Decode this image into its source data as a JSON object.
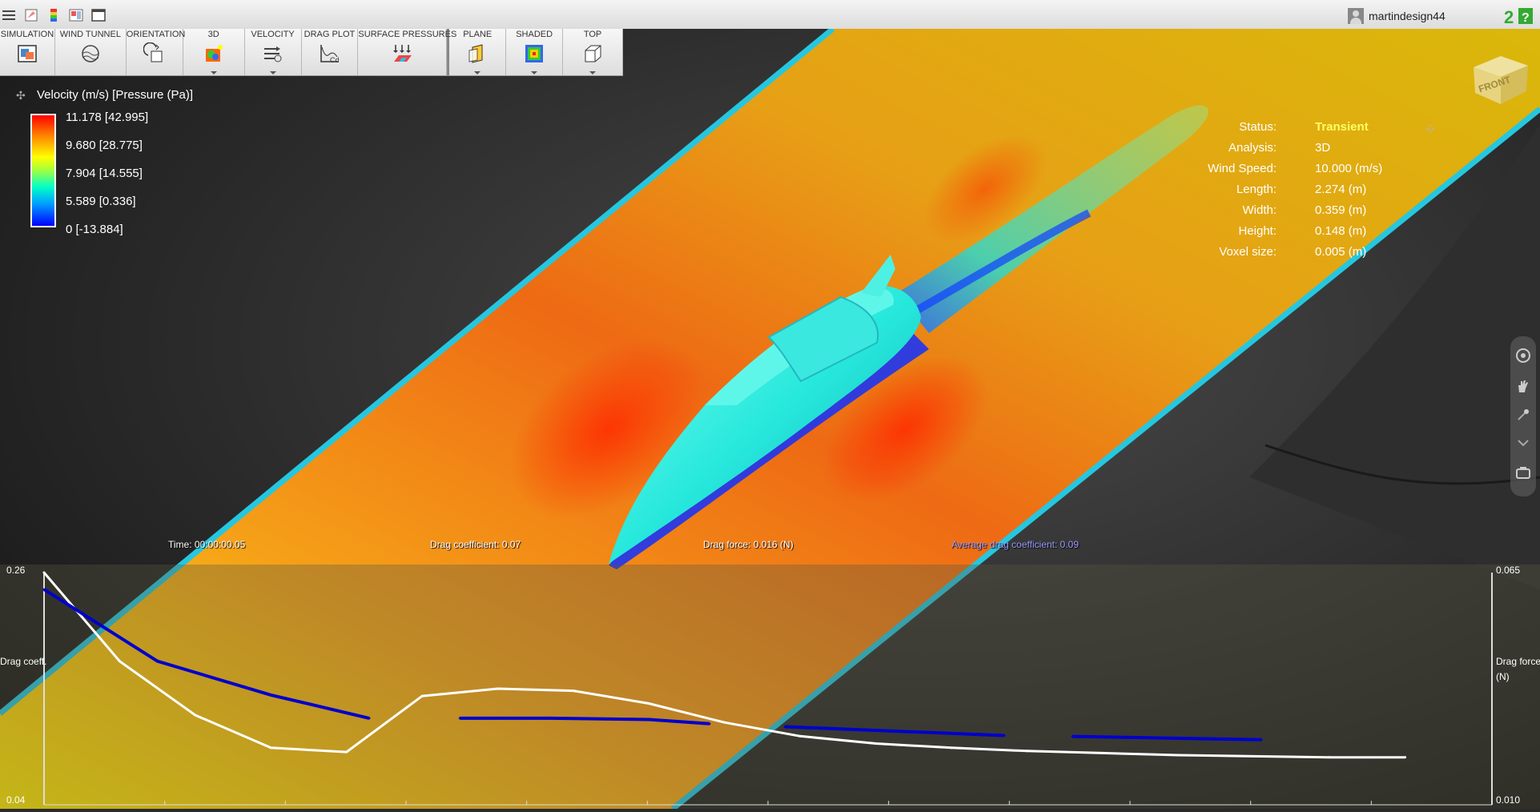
{
  "app": {
    "user": "martindesign44"
  },
  "ribbon": {
    "groups": [
      {
        "label": "SIMULATION",
        "icon": "simulation-icon"
      },
      {
        "label": "WIND TUNNEL",
        "icon": "wind-tunnel-icon"
      },
      {
        "label": "ORIENTATION",
        "icon": "orientation-icon"
      },
      {
        "label": "3D",
        "icon": "3d-icon"
      },
      {
        "label": "VELOCITY",
        "icon": "velocity-icon"
      },
      {
        "label": "DRAG PLOT",
        "icon": "drag-plot-icon"
      },
      {
        "label": "SURFACE PRESSURES",
        "icon": "surface-pressures-icon"
      },
      {
        "label": "PLANE",
        "icon": "plane-icon"
      },
      {
        "label": "SHADED",
        "icon": "shaded-icon"
      },
      {
        "label": "TOP",
        "icon": "top-view-icon"
      }
    ]
  },
  "legend": {
    "title": "Velocity (m/s) [Pressure (Pa)]",
    "ticks": [
      "11.178 [42.995]",
      "9.680 [28.775]",
      "7.904 [14.555]",
      "5.589 [0.336]",
      "0 [-13.884]"
    ]
  },
  "status": {
    "rows": [
      {
        "key": "Status:",
        "value": "Transient"
      },
      {
        "key": "Analysis:",
        "value": "3D"
      },
      {
        "key": "Wind Speed:",
        "value": "10.000 (m/s)"
      },
      {
        "key": "Length:",
        "value": "2.274 (m)"
      },
      {
        "key": "Width:",
        "value": "0.359 (m)"
      },
      {
        "key": "Height:",
        "value": "0.148 (m)"
      },
      {
        "key": "Voxel size:",
        "value": "0.005 (m)"
      }
    ]
  },
  "viewcube": {
    "face": "FRONT"
  },
  "readouts": {
    "time": "Time: 00:00:00.05",
    "drag_coefficient": "Drag coefficient: 0.07",
    "drag_force": "Drag force: 0.016 (N)",
    "avg_drag_coefficient": "Average drag coefficient: 0.09"
  },
  "colors": {
    "drag_coefficient_line": "#ffffff",
    "drag_force_line": "#0000cc",
    "avg_readout": "#9999ff"
  },
  "chart_data": {
    "type": "line",
    "left_axis": {
      "label": "Drag coeff.",
      "min": 0.04,
      "max": 0.26
    },
    "right_axis": {
      "label": "Drag force (N)",
      "min": 0.01,
      "max": 0.065
    },
    "series": [
      {
        "color": "#ffffff",
        "axis": "left",
        "x": [
          0,
          1,
          2,
          3,
          4,
          5,
          6,
          7,
          8,
          9,
          10,
          11,
          12,
          13,
          14,
          15,
          16,
          17,
          18
        ],
        "y": [
          0.26,
          0.176,
          0.125,
          0.094,
          0.09,
          0.143,
          0.15,
          0.148,
          0.136,
          0.118,
          0.105,
          0.098,
          0.094,
          0.091,
          0.089,
          0.087,
          0.086,
          0.085,
          0.085
        ]
      },
      {
        "color": "#0000cc",
        "axis": "right",
        "segments": [
          {
            "x": [
              0,
              1.5,
              3,
              4.3
            ],
            "y": [
              0.061,
              0.044,
              0.036,
              0.0305
            ]
          },
          {
            "x": [
              5.5,
              6.7,
              8,
              8.8
            ],
            "y": [
              0.0305,
              0.0305,
              0.0302,
              0.0292
            ]
          },
          {
            "x": [
              9.8,
              12.7
            ],
            "y": [
              0.0285,
              0.0264
            ]
          },
          {
            "x": [
              13.6,
              16.1
            ],
            "y": [
              0.0262,
              0.0254
            ]
          }
        ]
      }
    ]
  }
}
